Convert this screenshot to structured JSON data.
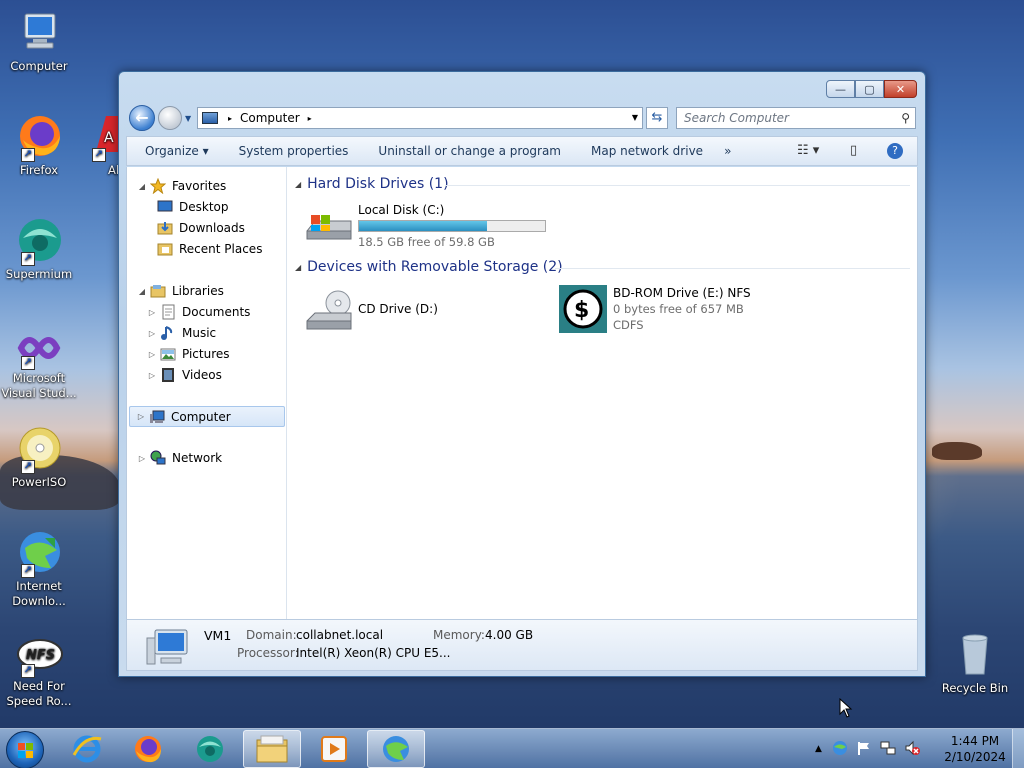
{
  "desktop": {
    "icons": [
      {
        "label": "Computer"
      },
      {
        "label": "Firefox"
      },
      {
        "label": "Alcoho..."
      },
      {
        "label": "Supermium"
      },
      {
        "label": "Microsoft Visual Stud..."
      },
      {
        "label": "PowerISO"
      },
      {
        "label": "Internet Downlo..."
      },
      {
        "label": "Need For Speed Ro..."
      },
      {
        "label": "Recycle Bin"
      }
    ]
  },
  "window": {
    "title_buttons": {
      "minimize": "—",
      "maximize": "▢",
      "close": "✕"
    },
    "address": {
      "crumb": "Computer",
      "sep": "▸"
    },
    "search_placeholder": "Search Computer",
    "toolbar": {
      "organize": "Organize ▾",
      "system_properties": "System properties",
      "uninstall": "Uninstall or change a program",
      "map_network": "Map network drive",
      "more": "»"
    },
    "nav": {
      "favorites": "Favorites",
      "desktop": "Desktop",
      "downloads": "Downloads",
      "recent_places": "Recent Places",
      "libraries": "Libraries",
      "documents": "Documents",
      "music": "Music",
      "pictures": "Pictures",
      "videos": "Videos",
      "computer": "Computer",
      "network": "Network"
    },
    "groups": {
      "hdd": "Hard Disk Drives (1)",
      "removable": "Devices with Removable Storage (2)"
    },
    "drives": {
      "c": {
        "name": "Local Disk (C:)",
        "free": "18.5 GB free of 59.8 GB",
        "used_fraction": 0.69
      },
      "d": {
        "name": "CD Drive (D:)"
      },
      "e": {
        "name": "BD-ROM Drive (E:) NFS",
        "free": "0 bytes free of 657 MB",
        "fs": "CDFS"
      }
    },
    "details": {
      "name": "VM1",
      "domain_label": "Domain:",
      "domain_value": "collabnet.local",
      "memory_label": "Memory:",
      "memory_value": "4.00 GB",
      "processor_label": "Processor:",
      "processor_value": "Intel(R) Xeon(R) CPU E5..."
    }
  },
  "taskbar": {
    "time": "1:44 PM",
    "date": "2/10/2024"
  }
}
